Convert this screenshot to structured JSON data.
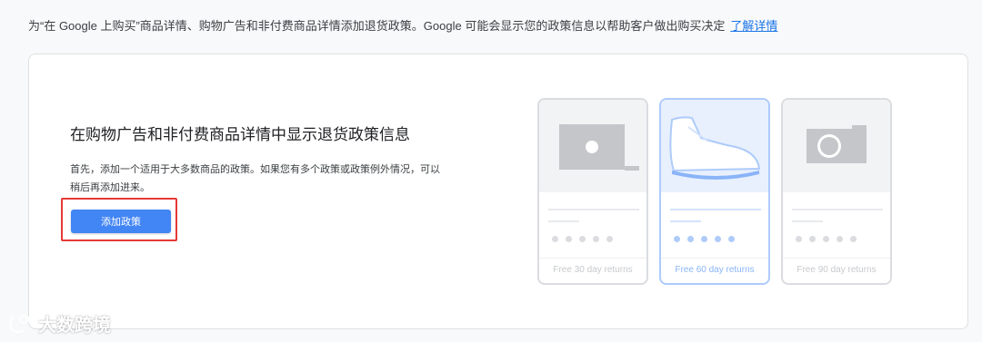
{
  "banner": {
    "text": "为“在 Google 上购买”商品详情、购物广告和非付费商品详情添加退货政策。Google 可能会显示您的政策信息以帮助客户做出购买决定",
    "learn_more": "了解详情"
  },
  "card": {
    "heading": "在购物广告和非付费商品详情中显示退货政策信息",
    "description": "首先，添加一个适用于大多数商品的政策。如果您有多个政策或政策例外情况，可以稍后再添加进来。",
    "add_button": "添加政策"
  },
  "illustrations": [
    {
      "icon": "laptop-icon",
      "label": "Free 30 day returns",
      "selected": false
    },
    {
      "icon": "sneaker-icon",
      "label": "Free 60 day returns",
      "selected": true
    },
    {
      "icon": "camera-icon",
      "label": "Free 90 day returns",
      "selected": false
    }
  ],
  "watermark": {
    "text": "大数跨境"
  },
  "colors": {
    "accent": "#4285f4",
    "link": "#1a73e8",
    "highlight_border": "#e53935",
    "selected_card_border": "#aecbfa"
  }
}
